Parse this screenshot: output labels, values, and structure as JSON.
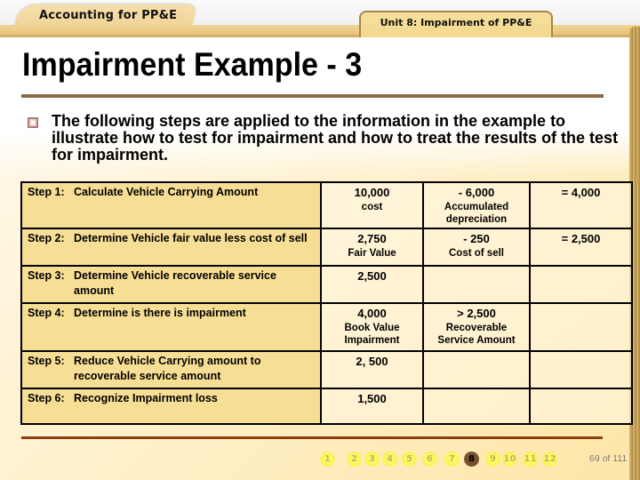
{
  "header": {
    "course_tab": "Accounting for PP&E",
    "unit_tab": "Unit 8: Impairment of PP&E"
  },
  "slide": {
    "title": "Impairment Example - 3",
    "intro": "The following steps are applied to the information in the example to illustrate how to test for impairment and how to treat the results of the test for impairment."
  },
  "steps": [
    {
      "label": "Step 1:",
      "text": "Calculate Vehicle Carrying Amount",
      "a_num": "10,000",
      "a_sub": "cost",
      "b_num": "- 6,000",
      "b_sub": "Accumulated depreciation",
      "c_num": "= 4,000",
      "c_sub": ""
    },
    {
      "label": "Step 2:",
      "text": "Determine Vehicle fair value less cost of sell",
      "a_num": "2,750",
      "a_sub": "Fair Value",
      "b_num": "- 250",
      "b_sub": "Cost of sell",
      "c_num": "= 2,500",
      "c_sub": ""
    },
    {
      "label": "Step 3:",
      "text": "Determine Vehicle recoverable service amount",
      "a_num": "2,500",
      "a_sub": "",
      "b_num": "",
      "b_sub": "",
      "c_num": "",
      "c_sub": ""
    },
    {
      "label": "Step 4:",
      "text": "Determine is there is impairment",
      "a_num": "4,000",
      "a_sub": "Book Value Impairment",
      "b_num": ">  2,500",
      "b_sub": "Recoverable Service Amount",
      "c_num": "",
      "c_sub": ""
    },
    {
      "label": "Step 5:",
      "text": "Reduce Vehicle Carrying amount to recoverable service amount",
      "a_num": "2, 500",
      "a_sub": "",
      "b_num": "",
      "b_sub": "",
      "c_num": "",
      "c_sub": ""
    },
    {
      "label": "Step 6:",
      "text": "Recognize Impairment loss",
      "a_num": "1,500",
      "a_sub": "",
      "b_num": "",
      "b_sub": "",
      "c_num": "",
      "c_sub": ""
    }
  ],
  "navigation": {
    "pages": [
      "1",
      "2",
      "3",
      "4",
      "5",
      "6",
      "7",
      "8",
      "9",
      "10",
      "11",
      "12"
    ],
    "current_page": "8",
    "slide_counter": "69 of 111"
  },
  "colors": {
    "step_cell": "#f7de95",
    "rule_brown": "#8c6a45",
    "bottom_rule": "#8b3f0c",
    "nav_dot": "#f8f45a",
    "nav_active": "#7a5530"
  }
}
